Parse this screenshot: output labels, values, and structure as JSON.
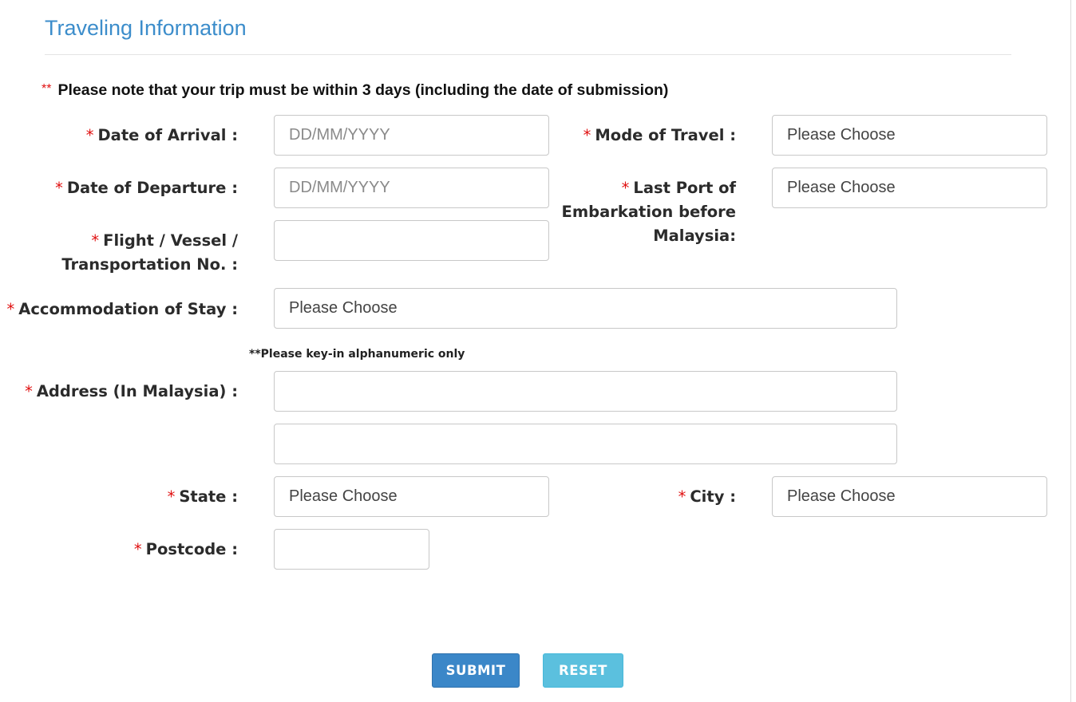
{
  "section": {
    "title": "Traveling Information"
  },
  "notice": {
    "prefix": "**",
    "text": "Please note that your trip must be within 3 days (including the date of submission)"
  },
  "required_mark": "*",
  "form": {
    "date_of_arrival": {
      "label": "Date of Arrival :",
      "placeholder": "DD/MM/YYYY"
    },
    "mode_of_travel": {
      "label": "Mode of Travel :",
      "value": "Please Choose"
    },
    "date_of_departure": {
      "label": "Date of Departure :",
      "placeholder": "DD/MM/YYYY"
    },
    "last_port": {
      "label_line1": "Last Port of",
      "label_line2": "Embarkation before",
      "label_line3": "Malaysia:",
      "value": "Please Choose"
    },
    "flight_no": {
      "label_line1": "Flight / Vessel /",
      "label_line2": "Transportation No. :",
      "value": ""
    },
    "accommodation": {
      "label": "Accommodation of Stay :",
      "value": "Please Choose"
    },
    "address": {
      "hint": "**Please key-in alphanumeric only",
      "label": "Address (In Malaysia) :",
      "line1": "",
      "line2": ""
    },
    "state": {
      "label": "State :",
      "value": "Please Choose"
    },
    "city": {
      "label": "City :",
      "value": "Please Choose"
    },
    "postcode": {
      "label": "Postcode :",
      "value": ""
    }
  },
  "buttons": {
    "submit": "SUBMIT",
    "reset": "RESET"
  },
  "colors": {
    "title": "#3c8dcb",
    "required": "#e01010",
    "submit": "#3b87c8",
    "reset": "#5bc0de"
  }
}
